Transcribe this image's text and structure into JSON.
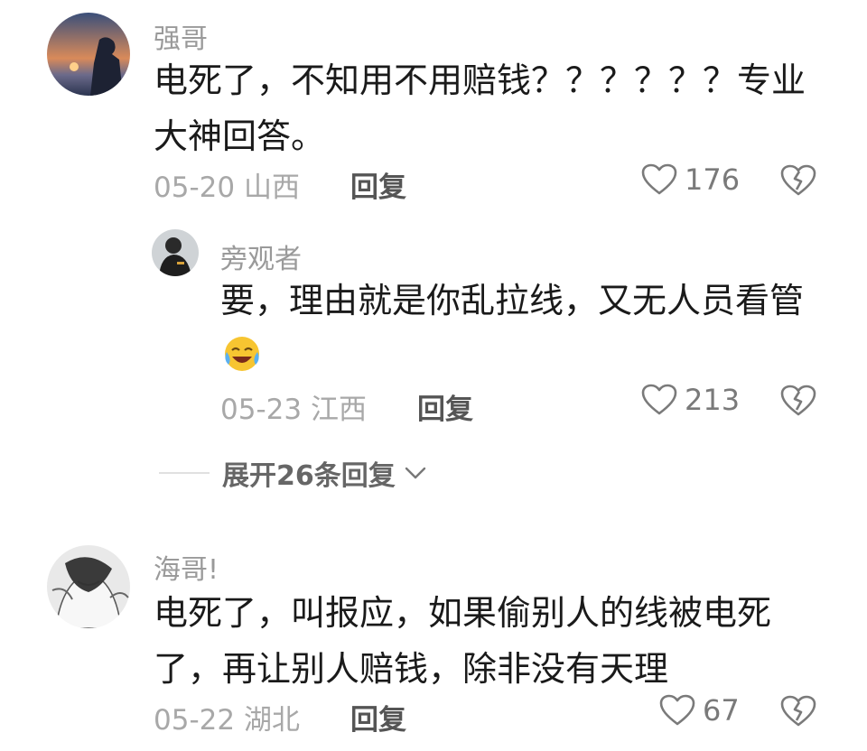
{
  "comments": [
    {
      "username": "强哥",
      "text": "电死了，不知用不用赔钱？？？？？？专业大神回答。",
      "date": "05-20",
      "location": "山西",
      "reply_label": "回复",
      "likes": "176"
    },
    {
      "username": "旁观者",
      "text": "要，理由就是你乱拉线，又无人员看管",
      "emoji": "crying-laughing-emoji",
      "date": "05-23",
      "location": "江西",
      "reply_label": "回复",
      "likes": "213"
    },
    {
      "username": "海哥!",
      "text": "电死了，叫报应，如果偷别人的线被电死了，再让别人赔钱，除非没有天理",
      "date": "05-22",
      "location": "湖北",
      "reply_label": "回复",
      "likes": "67"
    }
  ],
  "expand_replies": "展开26条回复",
  "icons": {
    "like": "heart-outline-icon",
    "dislike": "broken-heart-icon",
    "expand": "chevron-down-icon"
  },
  "colors": {
    "meta": "#a8a8a8",
    "text": "#1a1a1a"
  }
}
